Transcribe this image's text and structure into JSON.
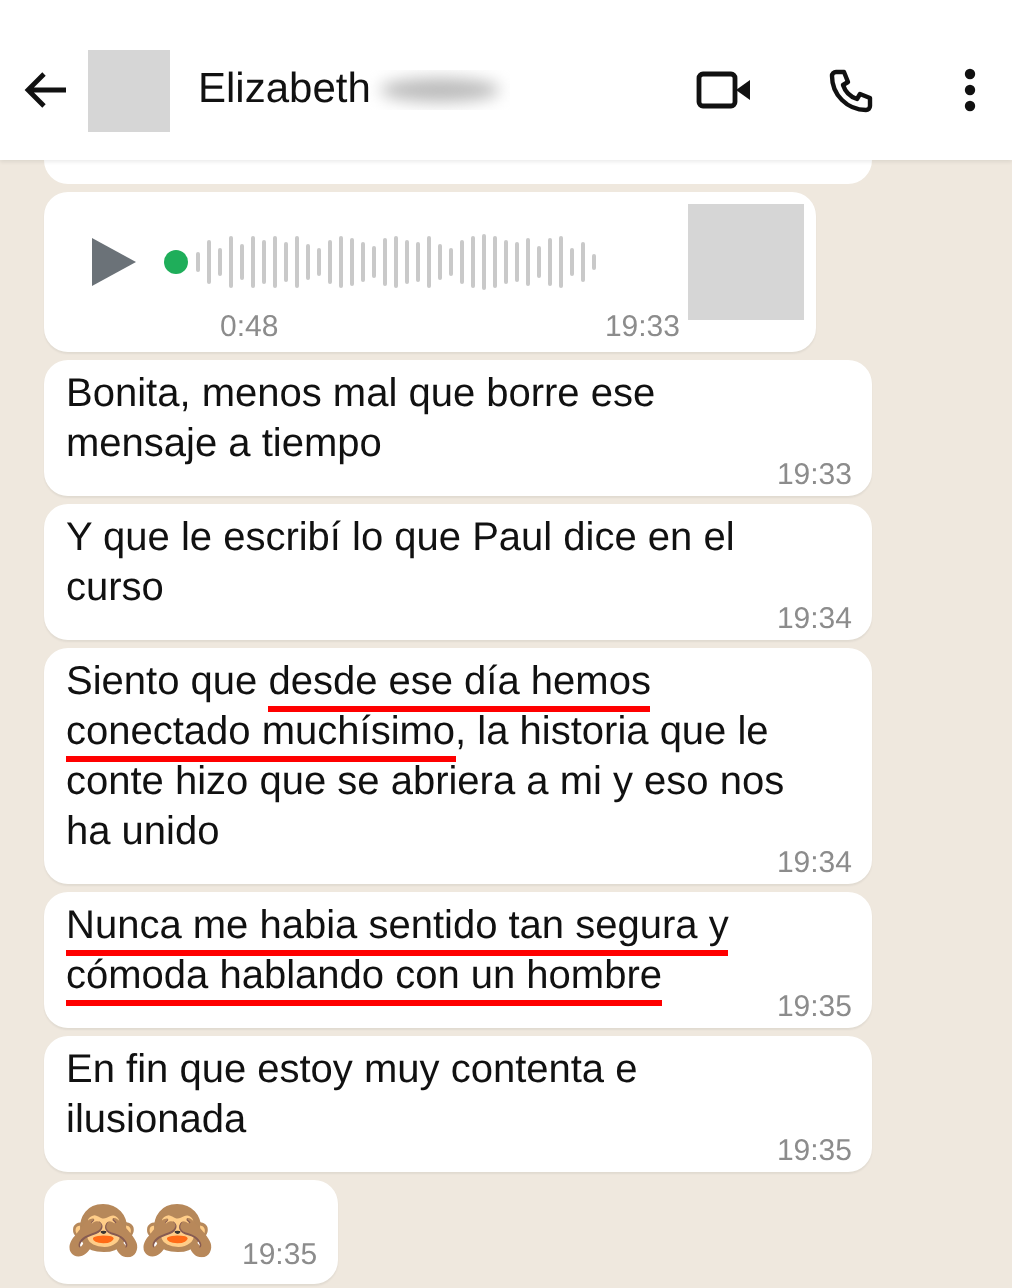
{
  "header": {
    "contact_name": "Elizabeth"
  },
  "messages": [
    {
      "kind": "fragment"
    },
    {
      "kind": "voice",
      "duration": "0:48",
      "time": "19:33"
    },
    {
      "kind": "text",
      "time": "19:33",
      "lines": [
        [
          {
            "text": "Bonita, menos mal que borre ese",
            "underlined": false
          }
        ],
        [
          {
            "text": "mensaje a tiempo",
            "underlined": false
          }
        ]
      ]
    },
    {
      "kind": "text",
      "time": "19:34",
      "lines": [
        [
          {
            "text": "Y que le escribí lo que Paul dice en el",
            "underlined": false
          }
        ],
        [
          {
            "text": "curso",
            "underlined": false
          }
        ]
      ]
    },
    {
      "kind": "text",
      "time": "19:34",
      "lines": [
        [
          {
            "text": "Siento que ",
            "underlined": false
          },
          {
            "text": "desde ese día hemos",
            "underlined": true
          }
        ],
        [
          {
            "text": "conectado muchísimo",
            "underlined": true
          },
          {
            "text": ", la historia que le",
            "underlined": false
          }
        ],
        [
          {
            "text": "conte hizo que se abriera a mi y eso nos",
            "underlined": false
          }
        ],
        [
          {
            "text": "ha unido",
            "underlined": false
          }
        ]
      ]
    },
    {
      "kind": "text",
      "time": "19:35",
      "lines": [
        [
          {
            "text": "Nunca me habia sentido tan segura y",
            "underlined": true
          }
        ],
        [
          {
            "text": "cómoda hablando con un hombre",
            "underlined": true
          }
        ]
      ]
    },
    {
      "kind": "text",
      "time": "19:35",
      "lines": [
        [
          {
            "text": "En fin que estoy muy contenta e",
            "underlined": false
          }
        ],
        [
          {
            "text": "ilusionada",
            "underlined": false
          }
        ]
      ]
    },
    {
      "kind": "emoji",
      "text": "🙈🙈",
      "time": "19:35"
    }
  ]
}
